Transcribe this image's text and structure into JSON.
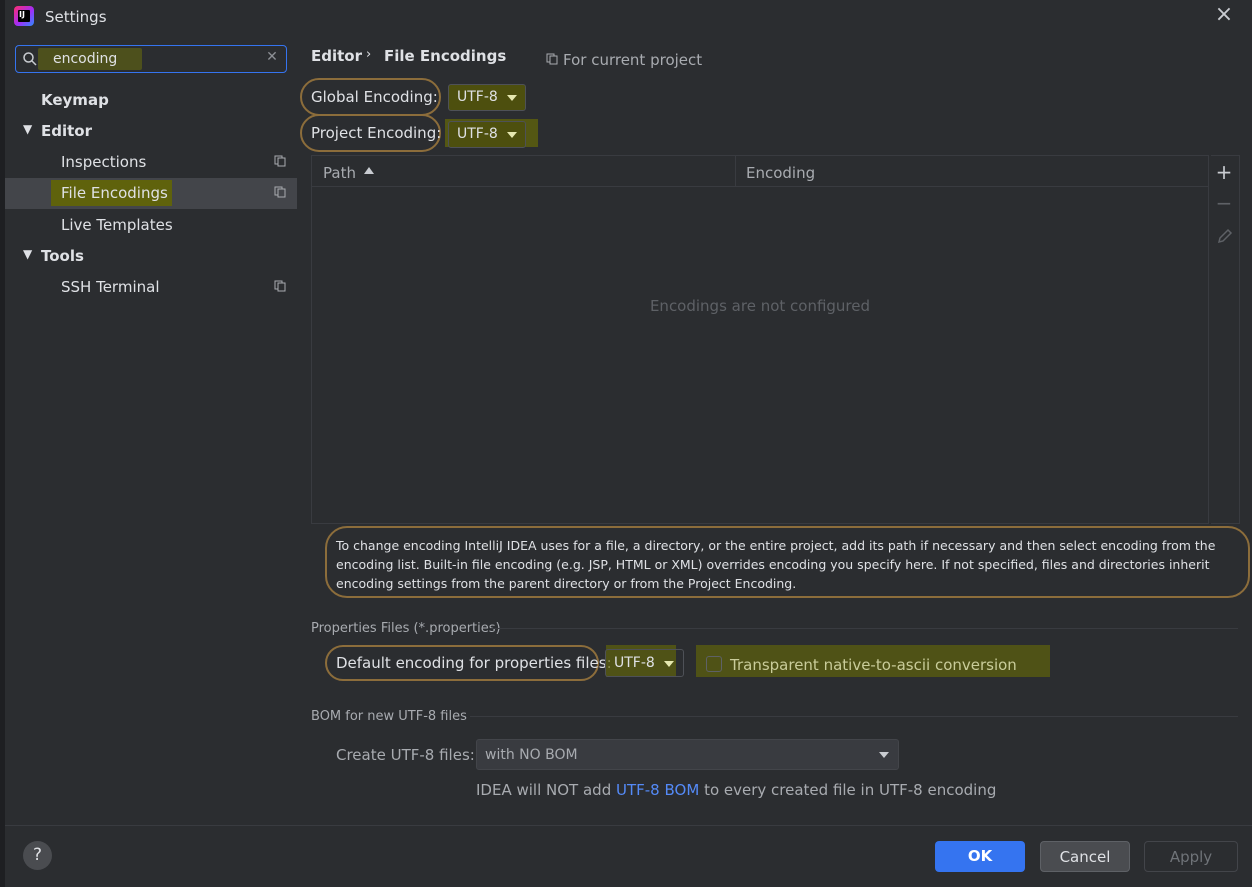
{
  "window": {
    "title": "Settings"
  },
  "search": {
    "value": "encoding"
  },
  "sidebar": {
    "items": [
      {
        "label": "Keymap"
      },
      {
        "label": "Editor"
      },
      {
        "label": "Inspections"
      },
      {
        "label": "File Encodings"
      },
      {
        "label": "Live Templates"
      },
      {
        "label": "Tools"
      },
      {
        "label": "SSH Terminal"
      }
    ]
  },
  "breadcrumb": {
    "parent": "Editor",
    "separator": "›",
    "current": "File Encodings",
    "scope": "For current project"
  },
  "encodings": {
    "global_label": "Global Encoding:",
    "global_value": "UTF-8",
    "project_label": "Project Encoding:",
    "project_value": "UTF-8"
  },
  "table": {
    "columns": [
      "Path",
      "Encoding"
    ],
    "empty_text": "Encodings are not configured"
  },
  "info": {
    "text": "To change encoding IntelliJ IDEA uses for a file, a directory, or the entire project, add its path if necessary and then select encoding from the encoding list. Built-in file encoding (e.g. JSP, HTML or XML) overrides encoding you specify here. If not specified, files and directories inherit encoding settings from the parent directory or from the Project Encoding."
  },
  "properties": {
    "section_title": "Properties Files (*.properties)",
    "default_label": "Default encoding for properties files:",
    "default_value": "UTF-8",
    "native_ascii_label": "Transparent native-to-ascii conversion",
    "native_ascii_checked": false
  },
  "bom": {
    "section_title": "BOM for new UTF-8 files",
    "create_label": "Create UTF-8 files:",
    "create_value": "with NO BOM",
    "note_prefix": "IDEA will NOT add",
    "note_link": "UTF-8 BOM",
    "note_suffix": "to every created file in UTF-8 encoding"
  },
  "buttons": {
    "help": "?",
    "ok": "OK",
    "cancel": "Cancel",
    "apply": "Apply"
  },
  "colors": {
    "background": "#2b2d30",
    "accent": "#3574f0",
    "highlight": "#5f620c",
    "annotation_outline": "#8c6d3b",
    "link": "#548af7"
  }
}
